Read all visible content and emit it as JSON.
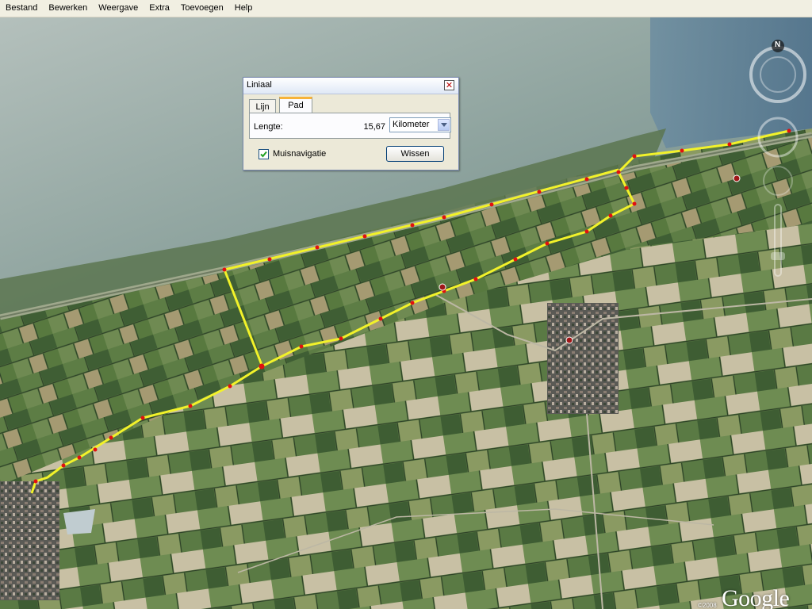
{
  "menu": {
    "items": [
      "Bestand",
      "Bewerken",
      "Weergave",
      "Extra",
      "Toevoegen",
      "Help"
    ]
  },
  "ruler": {
    "title": "Liniaal",
    "tabs": [
      "Lijn",
      "Pad"
    ],
    "active_tab": "Pad",
    "length_label": "Lengte:",
    "length_value": "15,67",
    "unit": "Kilometer",
    "mouse_nav_label": "Muisnavigatie",
    "mouse_nav_checked": true,
    "clear_button": "Wissen"
  },
  "navigation": {
    "north_label": "N"
  },
  "branding": {
    "logo": "Google",
    "copyright": "©2008"
  },
  "colors": {
    "path_line": "#f2f22a",
    "path_vertex": "#e01010",
    "tab_accent": "#f7b33a"
  }
}
